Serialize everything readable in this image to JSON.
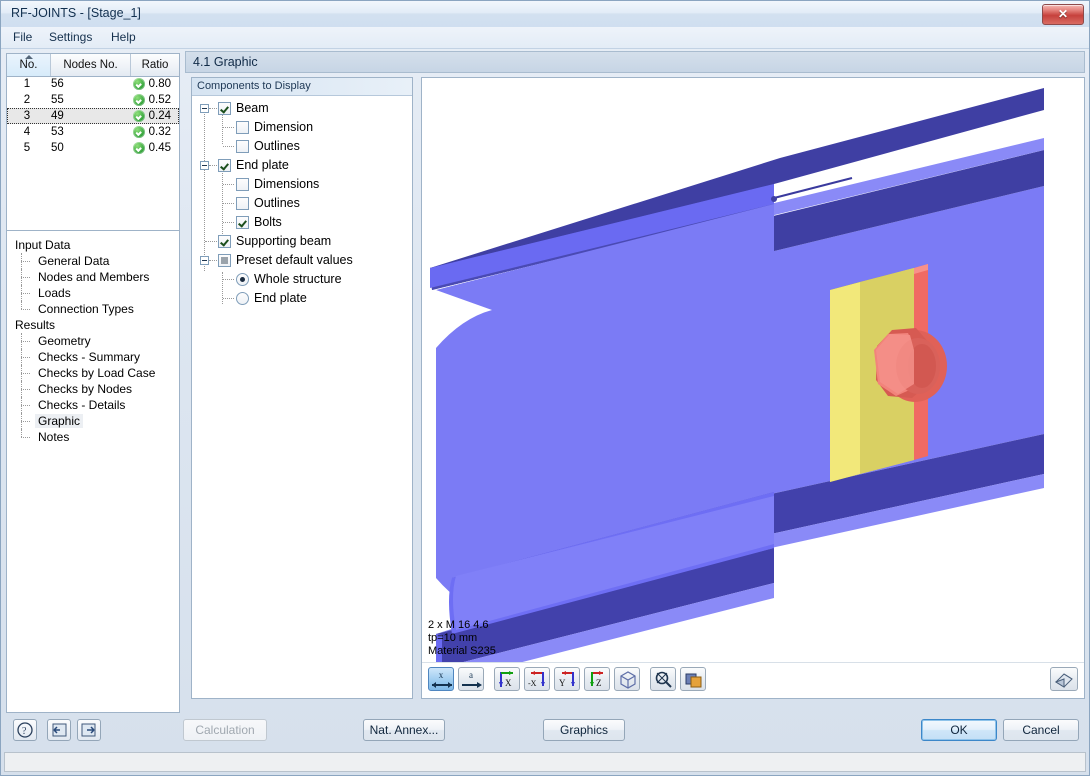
{
  "window": {
    "title": "RF-JOINTS - [Stage_1]",
    "close_label": "✕"
  },
  "menu": {
    "items": [
      {
        "label": "File"
      },
      {
        "label": "Settings"
      },
      {
        "label": "Help"
      }
    ]
  },
  "results_table": {
    "columns": [
      "No.",
      "Nodes No.",
      "Ratio"
    ],
    "sorted_column": "No.",
    "rows": [
      {
        "no": "1",
        "nodes_no": "56",
        "ratio": "0.80",
        "status": "ok"
      },
      {
        "no": "2",
        "nodes_no": "55",
        "ratio": "0.52",
        "status": "ok"
      },
      {
        "no": "3",
        "nodes_no": "49",
        "ratio": "0.24",
        "status": "ok"
      },
      {
        "no": "4",
        "nodes_no": "53",
        "ratio": "0.32",
        "status": "ok"
      },
      {
        "no": "5",
        "nodes_no": "50",
        "ratio": "0.45",
        "status": "ok"
      }
    ],
    "selected_row_index": 2
  },
  "navigator": {
    "groups": [
      {
        "label": "Input Data",
        "items": [
          {
            "label": "General Data",
            "active": false
          },
          {
            "label": "Nodes and Members",
            "active": false
          },
          {
            "label": "Loads",
            "active": false
          },
          {
            "label": "Connection Types",
            "active": false
          }
        ]
      },
      {
        "label": "Results",
        "items": [
          {
            "label": "Geometry",
            "active": false
          },
          {
            "label": "Checks - Summary",
            "active": false
          },
          {
            "label": "Checks by Load Case",
            "active": false
          },
          {
            "label": "Checks by Nodes",
            "active": false
          },
          {
            "label": "Checks - Details",
            "active": false
          },
          {
            "label": "Graphic",
            "active": true
          },
          {
            "label": "Notes",
            "active": false
          }
        ]
      }
    ]
  },
  "section": {
    "header": "4.1 Graphic"
  },
  "components_panel": {
    "header": "Components to Display",
    "nodes": [
      {
        "label": "Beam",
        "control": "checkbox",
        "state": "checked",
        "level": 0,
        "expander": true
      },
      {
        "label": "Dimension",
        "control": "checkbox",
        "state": "unchecked",
        "level": 1,
        "expander": false
      },
      {
        "label": "Outlines",
        "control": "checkbox",
        "state": "unchecked",
        "level": 1,
        "expander": false
      },
      {
        "label": "End plate",
        "control": "checkbox",
        "state": "checked",
        "level": 0,
        "expander": true
      },
      {
        "label": "Dimensions",
        "control": "checkbox",
        "state": "unchecked",
        "level": 1,
        "expander": false
      },
      {
        "label": "Outlines",
        "control": "checkbox",
        "state": "unchecked",
        "level": 1,
        "expander": false
      },
      {
        "label": "Bolts",
        "control": "checkbox",
        "state": "checked",
        "level": 1,
        "expander": false
      },
      {
        "label": "Supporting beam",
        "control": "checkbox",
        "state": "checked",
        "level": 0,
        "expander": false
      },
      {
        "label": "Preset default values",
        "control": "checkbox",
        "state": "indeterminate",
        "level": 0,
        "expander": true
      },
      {
        "label": "Whole structure",
        "control": "radio",
        "state": "checked",
        "level": 1,
        "expander": false
      },
      {
        "label": "End plate",
        "control": "radio",
        "state": "unchecked",
        "level": 1,
        "expander": false
      }
    ]
  },
  "graphic": {
    "annotation_lines": [
      "2 x M 16 4.6",
      "tp=10 mm",
      "Material S235"
    ],
    "colors": {
      "beam_web": "#7b7bf5",
      "beam_flange_top": "#3f3fa3",
      "end_plate": "#f2e87a",
      "end_plate_edge": "#8f8a35",
      "bolt": "#f06a63",
      "background": "#ffffff"
    },
    "toolbar": [
      {
        "name": "view-x-mirror",
        "glyph": "x",
        "active": true
      },
      {
        "name": "view-a-arrow",
        "glyph": "a",
        "active": false
      },
      {
        "name": "view-axis-x",
        "glyph": "X",
        "active": false
      },
      {
        "name": "view-axis-minus-x",
        "glyph": "-X",
        "active": false
      },
      {
        "name": "view-axis-y",
        "glyph": "Y",
        "active": false
      },
      {
        "name": "view-axis-z",
        "glyph": "Z",
        "active": false
      },
      {
        "name": "view-isometric",
        "glyph": "",
        "active": false
      },
      {
        "name": "view-zoom",
        "glyph": "",
        "active": false
      },
      {
        "name": "view-layers",
        "glyph": "",
        "active": false
      }
    ],
    "print_button": "print-icon"
  },
  "footer": {
    "icon_buttons": [
      {
        "name": "help-button",
        "glyph": "?"
      },
      {
        "name": "previous-button",
        "glyph": "◄"
      },
      {
        "name": "next-button",
        "glyph": "►"
      }
    ],
    "calculation_label": "Calculation",
    "calculation_disabled": true,
    "nat_annex_label": "Nat. Annex...",
    "graphics_label": "Graphics",
    "ok_label": "OK",
    "cancel_label": "Cancel"
  },
  "statusbar": {
    "text": ""
  }
}
